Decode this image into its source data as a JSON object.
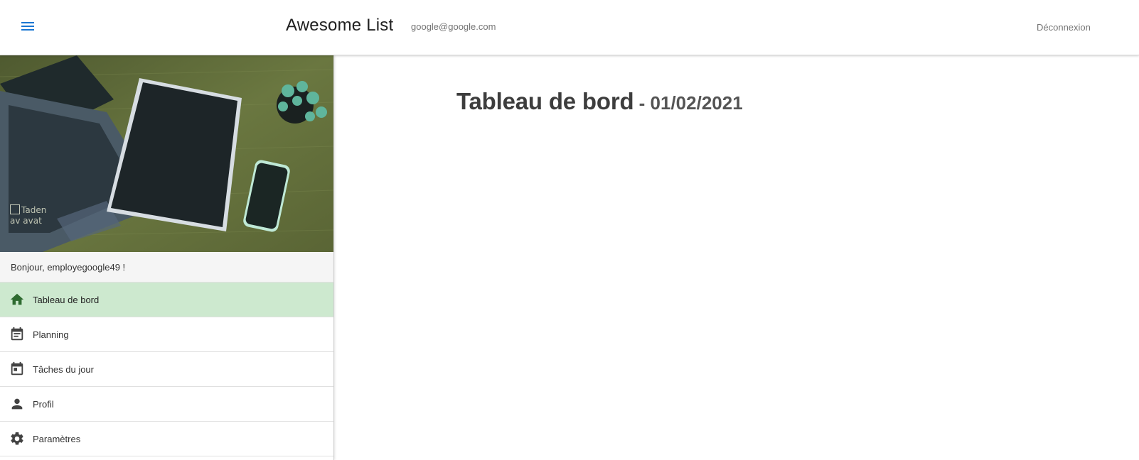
{
  "header": {
    "app_title": "Awesome List",
    "user_email": "google@google.com",
    "logout_label": "Déconnexion"
  },
  "sidebar": {
    "avatar_alt_text": "Taden av avat",
    "greeting": "Bonjour, employegoogle49 !",
    "items": [
      {
        "label": "Tableau de bord",
        "icon": "home-icon",
        "active": true
      },
      {
        "label": "Planning",
        "icon": "event-note-icon",
        "active": false
      },
      {
        "label": "Tâches du jour",
        "icon": "event-day-icon",
        "active": false
      },
      {
        "label": "Profil",
        "icon": "person-icon",
        "active": false
      },
      {
        "label": "Paramètres",
        "icon": "settings-icon",
        "active": false
      }
    ]
  },
  "main": {
    "title": "Tableau de bord",
    "date_separator": " - ",
    "date": "01/02/2021"
  },
  "colors": {
    "accent_blue": "#1976d2",
    "active_nav_bg": "#cde9cf",
    "active_nav_icon": "#2e6b30"
  }
}
